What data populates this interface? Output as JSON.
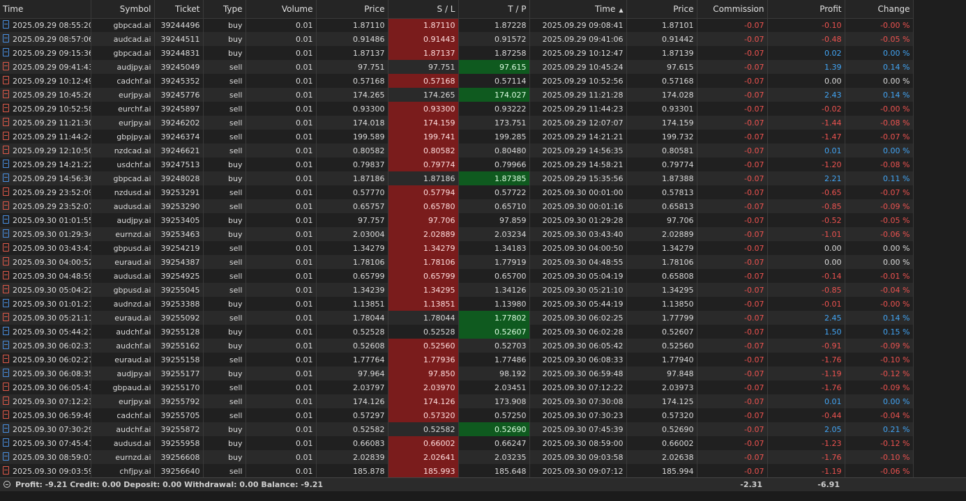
{
  "columns": {
    "time": "Time",
    "symbol": "Symbol",
    "ticket": "Ticket",
    "type": "Type",
    "volume": "Volume",
    "price": "Price",
    "sl": "S / L",
    "tp": "T / P",
    "close_time": "Time",
    "close_price": "Price",
    "commission": "Commission",
    "profit": "Profit",
    "change": "Change"
  },
  "sort_indicator_icon": "sort-up-arrow-icon",
  "rows": [
    {
      "time": "2025.09.29 08:55:20",
      "symbol": "gbpcad.ai",
      "ticket": "39244496",
      "type": "buy",
      "volume": "0.01",
      "price": "1.87110",
      "sl": "1.87110",
      "tp": "1.87228",
      "close_time": "2025.09.29 09:08:41",
      "close_price": "1.87101",
      "commission": "-0.07",
      "profit": "-0.10",
      "change": "-0.00 %",
      "hit": "sl"
    },
    {
      "time": "2025.09.29 08:57:06",
      "symbol": "audcad.ai",
      "ticket": "39244511",
      "type": "buy",
      "volume": "0.01",
      "price": "0.91486",
      "sl": "0.91443",
      "tp": "0.91572",
      "close_time": "2025.09.29 09:41:06",
      "close_price": "0.91442",
      "commission": "-0.07",
      "profit": "-0.48",
      "change": "-0.05 %",
      "hit": "sl"
    },
    {
      "time": "2025.09.29 09:15:36",
      "symbol": "gbpcad.ai",
      "ticket": "39244831",
      "type": "buy",
      "volume": "0.01",
      "price": "1.87137",
      "sl": "1.87137",
      "tp": "1.87258",
      "close_time": "2025.09.29 10:12:47",
      "close_price": "1.87139",
      "commission": "-0.07",
      "profit": "0.02",
      "change": "0.00 %",
      "hit": "sl"
    },
    {
      "time": "2025.09.29 09:41:43",
      "symbol": "audjpy.ai",
      "ticket": "39245049",
      "type": "sell",
      "volume": "0.01",
      "price": "97.751",
      "sl": "97.751",
      "tp": "97.615",
      "close_time": "2025.09.29 10:45:24",
      "close_price": "97.615",
      "commission": "-0.07",
      "profit": "1.39",
      "change": "0.14 %",
      "hit": "tp"
    },
    {
      "time": "2025.09.29 10:12:49",
      "symbol": "cadchf.ai",
      "ticket": "39245352",
      "type": "sell",
      "volume": "0.01",
      "price": "0.57168",
      "sl": "0.57168",
      "tp": "0.57114",
      "close_time": "2025.09.29 10:52:56",
      "close_price": "0.57168",
      "commission": "-0.07",
      "profit": "0.00",
      "change": "0.00 %",
      "hit": "sl"
    },
    {
      "time": "2025.09.29 10:45:26",
      "symbol": "eurjpy.ai",
      "ticket": "39245776",
      "type": "sell",
      "volume": "0.01",
      "price": "174.265",
      "sl": "174.265",
      "tp": "174.027",
      "close_time": "2025.09.29 11:21:28",
      "close_price": "174.028",
      "commission": "-0.07",
      "profit": "2.43",
      "change": "0.14 %",
      "hit": "tp"
    },
    {
      "time": "2025.09.29 10:52:58",
      "symbol": "eurchf.ai",
      "ticket": "39245897",
      "type": "sell",
      "volume": "0.01",
      "price": "0.93300",
      "sl": "0.93300",
      "tp": "0.93222",
      "close_time": "2025.09.29 11:44:23",
      "close_price": "0.93301",
      "commission": "-0.07",
      "profit": "-0.02",
      "change": "-0.00 %",
      "hit": "sl"
    },
    {
      "time": "2025.09.29 11:21:30",
      "symbol": "eurjpy.ai",
      "ticket": "39246202",
      "type": "sell",
      "volume": "0.01",
      "price": "174.018",
      "sl": "174.159",
      "tp": "173.751",
      "close_time": "2025.09.29 12:07:07",
      "close_price": "174.159",
      "commission": "-0.07",
      "profit": "-1.44",
      "change": "-0.08 %",
      "hit": "sl"
    },
    {
      "time": "2025.09.29 11:44:24",
      "symbol": "gbpjpy.ai",
      "ticket": "39246374",
      "type": "sell",
      "volume": "0.01",
      "price": "199.589",
      "sl": "199.741",
      "tp": "199.285",
      "close_time": "2025.09.29 14:21:21",
      "close_price": "199.732",
      "commission": "-0.07",
      "profit": "-1.47",
      "change": "-0.07 %",
      "hit": "sl"
    },
    {
      "time": "2025.09.29 12:10:50",
      "symbol": "nzdcad.ai",
      "ticket": "39246621",
      "type": "sell",
      "volume": "0.01",
      "price": "0.80582",
      "sl": "0.80582",
      "tp": "0.80480",
      "close_time": "2025.09.29 14:56:35",
      "close_price": "0.80581",
      "commission": "-0.07",
      "profit": "0.01",
      "change": "0.00 %",
      "hit": "sl"
    },
    {
      "time": "2025.09.29 14:21:22",
      "symbol": "usdchf.ai",
      "ticket": "39247513",
      "type": "buy",
      "volume": "0.01",
      "price": "0.79837",
      "sl": "0.79774",
      "tp": "0.79966",
      "close_time": "2025.09.29 14:58:21",
      "close_price": "0.79774",
      "commission": "-0.07",
      "profit": "-1.20",
      "change": "-0.08 %",
      "hit": "sl"
    },
    {
      "time": "2025.09.29 14:56:36",
      "symbol": "gbpcad.ai",
      "ticket": "39248028",
      "type": "buy",
      "volume": "0.01",
      "price": "1.87186",
      "sl": "1.87186",
      "tp": "1.87385",
      "close_time": "2025.09.29 15:35:56",
      "close_price": "1.87388",
      "commission": "-0.07",
      "profit": "2.21",
      "change": "0.11 %",
      "hit": "tp"
    },
    {
      "time": "2025.09.29 23:52:09",
      "symbol": "nzdusd.ai",
      "ticket": "39253291",
      "type": "sell",
      "volume": "0.01",
      "price": "0.57770",
      "sl": "0.57794",
      "tp": "0.57722",
      "close_time": "2025.09.30 00:01:00",
      "close_price": "0.57813",
      "commission": "-0.07",
      "profit": "-0.65",
      "change": "-0.07 %",
      "hit": "sl"
    },
    {
      "time": "2025.09.29 23:52:07",
      "symbol": "audusd.ai",
      "ticket": "39253290",
      "type": "sell",
      "volume": "0.01",
      "price": "0.65757",
      "sl": "0.65780",
      "tp": "0.65710",
      "close_time": "2025.09.30 00:01:16",
      "close_price": "0.65813",
      "commission": "-0.07",
      "profit": "-0.85",
      "change": "-0.09 %",
      "hit": "sl"
    },
    {
      "time": "2025.09.30 01:01:55",
      "symbol": "audjpy.ai",
      "ticket": "39253405",
      "type": "buy",
      "volume": "0.01",
      "price": "97.757",
      "sl": "97.706",
      "tp": "97.859",
      "close_time": "2025.09.30 01:29:28",
      "close_price": "97.706",
      "commission": "-0.07",
      "profit": "-0.52",
      "change": "-0.05 %",
      "hit": "sl"
    },
    {
      "time": "2025.09.30 01:29:34",
      "symbol": "eurnzd.ai",
      "ticket": "39253463",
      "type": "buy",
      "volume": "0.01",
      "price": "2.03004",
      "sl": "2.02889",
      "tp": "2.03234",
      "close_time": "2025.09.30 03:43:40",
      "close_price": "2.02889",
      "commission": "-0.07",
      "profit": "-1.01",
      "change": "-0.06 %",
      "hit": "sl"
    },
    {
      "time": "2025.09.30 03:43:41",
      "symbol": "gbpusd.ai",
      "ticket": "39254219",
      "type": "sell",
      "volume": "0.01",
      "price": "1.34279",
      "sl": "1.34279",
      "tp": "1.34183",
      "close_time": "2025.09.30 04:00:50",
      "close_price": "1.34279",
      "commission": "-0.07",
      "profit": "0.00",
      "change": "0.00 %",
      "hit": "sl"
    },
    {
      "time": "2025.09.30 04:00:52",
      "symbol": "euraud.ai",
      "ticket": "39254387",
      "type": "sell",
      "volume": "0.01",
      "price": "1.78106",
      "sl": "1.78106",
      "tp": "1.77919",
      "close_time": "2025.09.30 04:48:55",
      "close_price": "1.78106",
      "commission": "-0.07",
      "profit": "0.00",
      "change": "0.00 %",
      "hit": "sl"
    },
    {
      "time": "2025.09.30 04:48:59",
      "symbol": "audusd.ai",
      "ticket": "39254925",
      "type": "sell",
      "volume": "0.01",
      "price": "0.65799",
      "sl": "0.65799",
      "tp": "0.65700",
      "close_time": "2025.09.30 05:04:19",
      "close_price": "0.65808",
      "commission": "-0.07",
      "profit": "-0.14",
      "change": "-0.01 %",
      "hit": "sl"
    },
    {
      "time": "2025.09.30 05:04:22",
      "symbol": "gbpusd.ai",
      "ticket": "39255045",
      "type": "sell",
      "volume": "0.01",
      "price": "1.34239",
      "sl": "1.34295",
      "tp": "1.34126",
      "close_time": "2025.09.30 05:21:10",
      "close_price": "1.34295",
      "commission": "-0.07",
      "profit": "-0.85",
      "change": "-0.04 %",
      "hit": "sl"
    },
    {
      "time": "2025.09.30 01:01:21",
      "symbol": "audnzd.ai",
      "ticket": "39253388",
      "type": "buy",
      "volume": "0.01",
      "price": "1.13851",
      "sl": "1.13851",
      "tp": "1.13980",
      "close_time": "2025.09.30 05:44:19",
      "close_price": "1.13850",
      "commission": "-0.07",
      "profit": "-0.01",
      "change": "-0.00 %",
      "hit": "sl"
    },
    {
      "time": "2025.09.30 05:21:11",
      "symbol": "euraud.ai",
      "ticket": "39255092",
      "type": "sell",
      "volume": "0.01",
      "price": "1.78044",
      "sl": "1.78044",
      "tp": "1.77802",
      "close_time": "2025.09.30 06:02:25",
      "close_price": "1.77799",
      "commission": "-0.07",
      "profit": "2.45",
      "change": "0.14 %",
      "hit": "tp"
    },
    {
      "time": "2025.09.30 05:44:21",
      "symbol": "audchf.ai",
      "ticket": "39255128",
      "type": "buy",
      "volume": "0.01",
      "price": "0.52528",
      "sl": "0.52528",
      "tp": "0.52607",
      "close_time": "2025.09.30 06:02:28",
      "close_price": "0.52607",
      "commission": "-0.07",
      "profit": "1.50",
      "change": "0.15 %",
      "hit": "tp"
    },
    {
      "time": "2025.09.30 06:02:31",
      "symbol": "audchf.ai",
      "ticket": "39255162",
      "type": "buy",
      "volume": "0.01",
      "price": "0.52608",
      "sl": "0.52560",
      "tp": "0.52703",
      "close_time": "2025.09.30 06:05:42",
      "close_price": "0.52560",
      "commission": "-0.07",
      "profit": "-0.91",
      "change": "-0.09 %",
      "hit": "sl"
    },
    {
      "time": "2025.09.30 06:02:27",
      "symbol": "euraud.ai",
      "ticket": "39255158",
      "type": "sell",
      "volume": "0.01",
      "price": "1.77764",
      "sl": "1.77936",
      "tp": "1.77486",
      "close_time": "2025.09.30 06:08:33",
      "close_price": "1.77940",
      "commission": "-0.07",
      "profit": "-1.76",
      "change": "-0.10 %",
      "hit": "sl"
    },
    {
      "time": "2025.09.30 06:08:35",
      "symbol": "audjpy.ai",
      "ticket": "39255177",
      "type": "buy",
      "volume": "0.01",
      "price": "97.964",
      "sl": "97.850",
      "tp": "98.192",
      "close_time": "2025.09.30 06:59:48",
      "close_price": "97.848",
      "commission": "-0.07",
      "profit": "-1.19",
      "change": "-0.12 %",
      "hit": "sl"
    },
    {
      "time": "2025.09.30 06:05:43",
      "symbol": "gbpaud.ai",
      "ticket": "39255170",
      "type": "sell",
      "volume": "0.01",
      "price": "2.03797",
      "sl": "2.03970",
      "tp": "2.03451",
      "close_time": "2025.09.30 07:12:22",
      "close_price": "2.03973",
      "commission": "-0.07",
      "profit": "-1.76",
      "change": "-0.09 %",
      "hit": "sl"
    },
    {
      "time": "2025.09.30 07:12:23",
      "symbol": "eurjpy.ai",
      "ticket": "39255792",
      "type": "sell",
      "volume": "0.01",
      "price": "174.126",
      "sl": "174.126",
      "tp": "173.908",
      "close_time": "2025.09.30 07:30:08",
      "close_price": "174.125",
      "commission": "-0.07",
      "profit": "0.01",
      "change": "0.00 %",
      "hit": "sl"
    },
    {
      "time": "2025.09.30 06:59:49",
      "symbol": "cadchf.ai",
      "ticket": "39255705",
      "type": "sell",
      "volume": "0.01",
      "price": "0.57297",
      "sl": "0.57320",
      "tp": "0.57250",
      "close_time": "2025.09.30 07:30:23",
      "close_price": "0.57320",
      "commission": "-0.07",
      "profit": "-0.44",
      "change": "-0.04 %",
      "hit": "sl"
    },
    {
      "time": "2025.09.30 07:30:29",
      "symbol": "audchf.ai",
      "ticket": "39255872",
      "type": "buy",
      "volume": "0.01",
      "price": "0.52582",
      "sl": "0.52582",
      "tp": "0.52690",
      "close_time": "2025.09.30 07:45:39",
      "close_price": "0.52690",
      "commission": "-0.07",
      "profit": "2.05",
      "change": "0.21 %",
      "hit": "tp"
    },
    {
      "time": "2025.09.30 07:45:41",
      "symbol": "audusd.ai",
      "ticket": "39255958",
      "type": "buy",
      "volume": "0.01",
      "price": "0.66083",
      "sl": "0.66002",
      "tp": "0.66247",
      "close_time": "2025.09.30 08:59:00",
      "close_price": "0.66002",
      "commission": "-0.07",
      "profit": "-1.23",
      "change": "-0.12 %",
      "hit": "sl"
    },
    {
      "time": "2025.09.30 08:59:01",
      "symbol": "eurnzd.ai",
      "ticket": "39256608",
      "type": "buy",
      "volume": "0.01",
      "price": "2.02839",
      "sl": "2.02641",
      "tp": "2.03235",
      "close_time": "2025.09.30 09:03:58",
      "close_price": "2.02638",
      "commission": "-0.07",
      "profit": "-1.76",
      "change": "-0.10 %",
      "hit": "sl"
    },
    {
      "time": "2025.09.30 09:03:59",
      "symbol": "chfjpy.ai",
      "ticket": "39256640",
      "type": "sell",
      "volume": "0.01",
      "price": "185.878",
      "sl": "185.993",
      "tp": "185.648",
      "close_time": "2025.09.30 09:07:12",
      "close_price": "185.994",
      "commission": "-0.07",
      "profit": "-1.19",
      "change": "-0.06 %",
      "hit": "sl"
    }
  ],
  "footer": {
    "summary": "Profit: -9.21  Credit: 0.00  Deposit: 0.00  Withdrawal: 0.00  Balance: -9.21",
    "commission_total": "-2.31",
    "profit_total": "-6.91",
    "collapse_icon": "collapse-circle-icon"
  },
  "colors": {
    "background": "#1e1e1e",
    "sl_hit": "#7a1c1c",
    "tp_hit": "#0f5a1f",
    "negative": "#ef5350",
    "positive": "#42a5f5"
  }
}
